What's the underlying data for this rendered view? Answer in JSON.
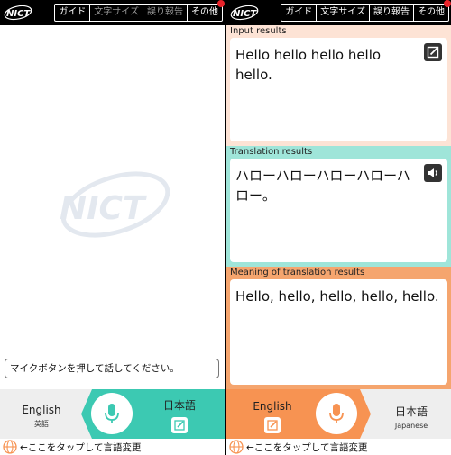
{
  "header": {
    "menu": [
      "ガイド",
      "文字サイズ",
      "誤り報告",
      "その他"
    ]
  },
  "logo_text": "NICT",
  "left": {
    "hint": "マイクボタンを押して話してください。",
    "lang_source": {
      "name": "English",
      "sub": "英語"
    },
    "lang_target": {
      "name": "日本語"
    }
  },
  "right": {
    "input": {
      "label": "Input results",
      "text": "Hello hello hello hello hello."
    },
    "translation": {
      "label": "Translation results",
      "text": "ハローハローハローハローハロー。"
    },
    "meaning": {
      "label": "Meaning of translation results",
      "text": "Hello, hello, hello, hello, hello."
    },
    "lang_source": {
      "name": "English"
    },
    "lang_target": {
      "name": "日本語",
      "sub": "Japanese"
    }
  },
  "bottom_hint": "←ここをタップして言語変更",
  "colors": {
    "teal": "#3cc9b2",
    "orange": "#f79352",
    "input_bg": "#fde3d5",
    "translation_bg": "#9fe5d9",
    "meaning_bg": "#f5a56e"
  },
  "icons": [
    "mic-icon",
    "edit-icon",
    "speaker-icon",
    "globe-icon",
    "notification-dot"
  ]
}
